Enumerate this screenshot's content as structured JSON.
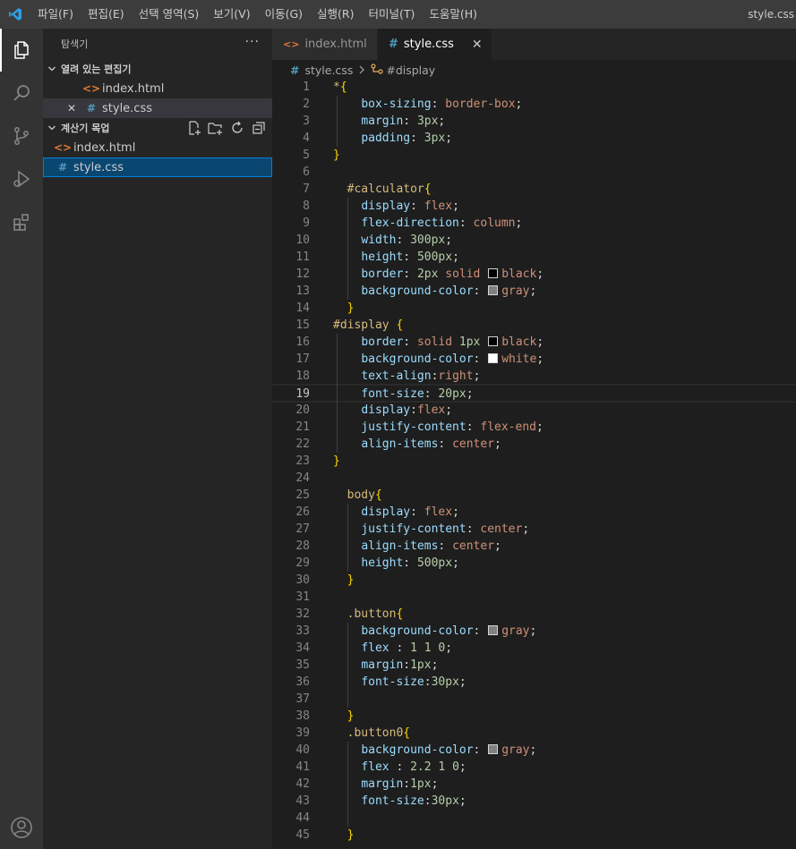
{
  "titlebar": {
    "menu": [
      "파일(F)",
      "편집(E)",
      "선택 영역(S)",
      "보기(V)",
      "이동(G)",
      "실행(R)",
      "터미널(T)",
      "도움말(H)"
    ],
    "window_title": "style.css"
  },
  "activity_bar": [
    "explorer-icon",
    "search-icon",
    "source-control-icon",
    "run-debug-icon",
    "extensions-icon",
    "account-icon"
  ],
  "sidebar": {
    "title": "탐색기",
    "more": "···",
    "open_editors": {
      "label": "열려 있는 편집기",
      "files": [
        {
          "name": "index.html",
          "icon": "html-file-icon"
        },
        {
          "name": "style.css",
          "icon": "css-file-icon",
          "close": "✕"
        }
      ]
    },
    "workspace": {
      "label": "계산기 목업",
      "files": [
        {
          "name": "index.html",
          "icon": "html-file-icon"
        },
        {
          "name": "style.css",
          "icon": "css-file-icon"
        }
      ]
    }
  },
  "tabs": [
    {
      "label": "index.html",
      "icon": "html-file-icon"
    },
    {
      "label": "style.css",
      "icon": "css-file-icon",
      "close": "✕"
    }
  ],
  "breadcrumb": {
    "file": "style.css",
    "symbol": "#display"
  },
  "editor": {
    "current_line": 19,
    "colors": {
      "black": "#000000",
      "gray": "#808080",
      "white": "#ffffff"
    },
    "lines": [
      [
        [
          "star",
          "*"
        ],
        [
          "brace",
          "{"
        ]
      ],
      [
        [
          "ws",
          "    "
        ],
        [
          "prop",
          "box-sizing"
        ],
        [
          "plain",
          ": "
        ],
        [
          "val",
          "border-box"
        ],
        [
          "plain",
          ";"
        ]
      ],
      [
        [
          "ws",
          "    "
        ],
        [
          "prop",
          "margin"
        ],
        [
          "plain",
          ": "
        ],
        [
          "num",
          "3px"
        ],
        [
          "plain",
          ";"
        ]
      ],
      [
        [
          "ws",
          "    "
        ],
        [
          "prop",
          "padding"
        ],
        [
          "plain",
          ": "
        ],
        [
          "num",
          "3px"
        ],
        [
          "plain",
          ";"
        ]
      ],
      [
        [
          "brace",
          "}"
        ]
      ],
      [],
      [
        [
          "ws",
          "  "
        ],
        [
          "sel",
          "#calculator"
        ],
        [
          "brace",
          "{"
        ]
      ],
      [
        [
          "ws",
          "    "
        ],
        [
          "prop",
          "display"
        ],
        [
          "plain",
          ": "
        ],
        [
          "val",
          "flex"
        ],
        [
          "plain",
          ";"
        ]
      ],
      [
        [
          "ws",
          "    "
        ],
        [
          "prop",
          "flex-direction"
        ],
        [
          "plain",
          ": "
        ],
        [
          "val",
          "column"
        ],
        [
          "plain",
          ";"
        ]
      ],
      [
        [
          "ws",
          "    "
        ],
        [
          "prop",
          "width"
        ],
        [
          "plain",
          ": "
        ],
        [
          "num",
          "300px"
        ],
        [
          "plain",
          ";"
        ]
      ],
      [
        [
          "ws",
          "    "
        ],
        [
          "prop",
          "height"
        ],
        [
          "plain",
          ": "
        ],
        [
          "num",
          "500px"
        ],
        [
          "plain",
          ";"
        ]
      ],
      [
        [
          "ws",
          "    "
        ],
        [
          "prop",
          "border"
        ],
        [
          "plain",
          ": "
        ],
        [
          "num",
          "2px"
        ],
        [
          "plain",
          " "
        ],
        [
          "val",
          "solid"
        ],
        [
          "plain",
          " "
        ],
        [
          "swatch",
          "black"
        ],
        [
          "val",
          "black"
        ],
        [
          "plain",
          ";"
        ]
      ],
      [
        [
          "ws",
          "    "
        ],
        [
          "prop",
          "background-color"
        ],
        [
          "plain",
          ": "
        ],
        [
          "swatch",
          "gray"
        ],
        [
          "val",
          "gray"
        ],
        [
          "plain",
          ";"
        ]
      ],
      [
        [
          "ws",
          "  "
        ],
        [
          "brace",
          "}"
        ]
      ],
      [
        [
          "sel",
          "#display"
        ],
        [
          "plain",
          " "
        ],
        [
          "brace",
          "{"
        ]
      ],
      [
        [
          "ws",
          "    "
        ],
        [
          "prop",
          "border"
        ],
        [
          "plain",
          ": "
        ],
        [
          "val",
          "solid"
        ],
        [
          "plain",
          " "
        ],
        [
          "num",
          "1px"
        ],
        [
          "plain",
          " "
        ],
        [
          "swatch",
          "black"
        ],
        [
          "val",
          "black"
        ],
        [
          "plain",
          ";"
        ]
      ],
      [
        [
          "ws",
          "    "
        ],
        [
          "prop",
          "background-color"
        ],
        [
          "plain",
          ": "
        ],
        [
          "swatch",
          "white"
        ],
        [
          "val",
          "white"
        ],
        [
          "plain",
          ";"
        ]
      ],
      [
        [
          "ws",
          "    "
        ],
        [
          "prop",
          "text-align"
        ],
        [
          "plain",
          ":"
        ],
        [
          "val",
          "right"
        ],
        [
          "plain",
          ";"
        ]
      ],
      [
        [
          "ws",
          "    "
        ],
        [
          "prop",
          "font-size"
        ],
        [
          "plain",
          ": "
        ],
        [
          "num",
          "20px"
        ],
        [
          "plain",
          ";"
        ]
      ],
      [
        [
          "ws",
          "    "
        ],
        [
          "prop",
          "display"
        ],
        [
          "plain",
          ":"
        ],
        [
          "val",
          "flex"
        ],
        [
          "plain",
          ";"
        ]
      ],
      [
        [
          "ws",
          "    "
        ],
        [
          "prop",
          "justify-content"
        ],
        [
          "plain",
          ": "
        ],
        [
          "val",
          "flex-end"
        ],
        [
          "plain",
          ";"
        ]
      ],
      [
        [
          "ws",
          "    "
        ],
        [
          "prop",
          "align-items"
        ],
        [
          "plain",
          ": "
        ],
        [
          "val",
          "center"
        ],
        [
          "plain",
          ";"
        ]
      ],
      [
        [
          "brace",
          "}"
        ]
      ],
      [],
      [
        [
          "ws",
          "  "
        ],
        [
          "sel",
          "body"
        ],
        [
          "brace",
          "{"
        ]
      ],
      [
        [
          "ws",
          "    "
        ],
        [
          "prop",
          "display"
        ],
        [
          "plain",
          ": "
        ],
        [
          "val",
          "flex"
        ],
        [
          "plain",
          ";"
        ]
      ],
      [
        [
          "ws",
          "    "
        ],
        [
          "prop",
          "justify-content"
        ],
        [
          "plain",
          ": "
        ],
        [
          "val",
          "center"
        ],
        [
          "plain",
          ";"
        ]
      ],
      [
        [
          "ws",
          "    "
        ],
        [
          "prop",
          "align-items"
        ],
        [
          "plain",
          ": "
        ],
        [
          "val",
          "center"
        ],
        [
          "plain",
          ";"
        ]
      ],
      [
        [
          "ws",
          "    "
        ],
        [
          "prop",
          "height"
        ],
        [
          "plain",
          ": "
        ],
        [
          "num",
          "500px"
        ],
        [
          "plain",
          ";"
        ]
      ],
      [
        [
          "ws",
          "  "
        ],
        [
          "brace",
          "}"
        ]
      ],
      [],
      [
        [
          "ws",
          "  "
        ],
        [
          "sel",
          ".button"
        ],
        [
          "brace",
          "{"
        ]
      ],
      [
        [
          "ws",
          "    "
        ],
        [
          "prop",
          "background-color"
        ],
        [
          "plain",
          ": "
        ],
        [
          "swatch",
          "gray"
        ],
        [
          "val",
          "gray"
        ],
        [
          "plain",
          ";"
        ]
      ],
      [
        [
          "ws",
          "    "
        ],
        [
          "prop",
          "flex"
        ],
        [
          "plain",
          " : "
        ],
        [
          "num",
          "1 1 0"
        ],
        [
          "plain",
          ";"
        ]
      ],
      [
        [
          "ws",
          "    "
        ],
        [
          "prop",
          "margin"
        ],
        [
          "plain",
          ":"
        ],
        [
          "num",
          "1px"
        ],
        [
          "plain",
          ";"
        ]
      ],
      [
        [
          "ws",
          "    "
        ],
        [
          "prop",
          "font-size"
        ],
        [
          "plain",
          ":"
        ],
        [
          "num",
          "30px"
        ],
        [
          "plain",
          ";"
        ]
      ],
      [],
      [
        [
          "ws",
          "  "
        ],
        [
          "brace",
          "}"
        ]
      ],
      [
        [
          "ws",
          "  "
        ],
        [
          "sel",
          ".button0"
        ],
        [
          "brace",
          "{"
        ]
      ],
      [
        [
          "ws",
          "    "
        ],
        [
          "prop",
          "background-color"
        ],
        [
          "plain",
          ": "
        ],
        [
          "swatch",
          "gray"
        ],
        [
          "val",
          "gray"
        ],
        [
          "plain",
          ";"
        ]
      ],
      [
        [
          "ws",
          "    "
        ],
        [
          "prop",
          "flex"
        ],
        [
          "plain",
          " : "
        ],
        [
          "num",
          "2.2 1 0"
        ],
        [
          "plain",
          ";"
        ]
      ],
      [
        [
          "ws",
          "    "
        ],
        [
          "prop",
          "margin"
        ],
        [
          "plain",
          ":"
        ],
        [
          "num",
          "1px"
        ],
        [
          "plain",
          ";"
        ]
      ],
      [
        [
          "ws",
          "    "
        ],
        [
          "prop",
          "font-size"
        ],
        [
          "plain",
          ":"
        ],
        [
          "num",
          "30px"
        ],
        [
          "plain",
          ";"
        ]
      ],
      [],
      [
        [
          "ws",
          "  "
        ],
        [
          "brace",
          "}"
        ]
      ]
    ]
  }
}
